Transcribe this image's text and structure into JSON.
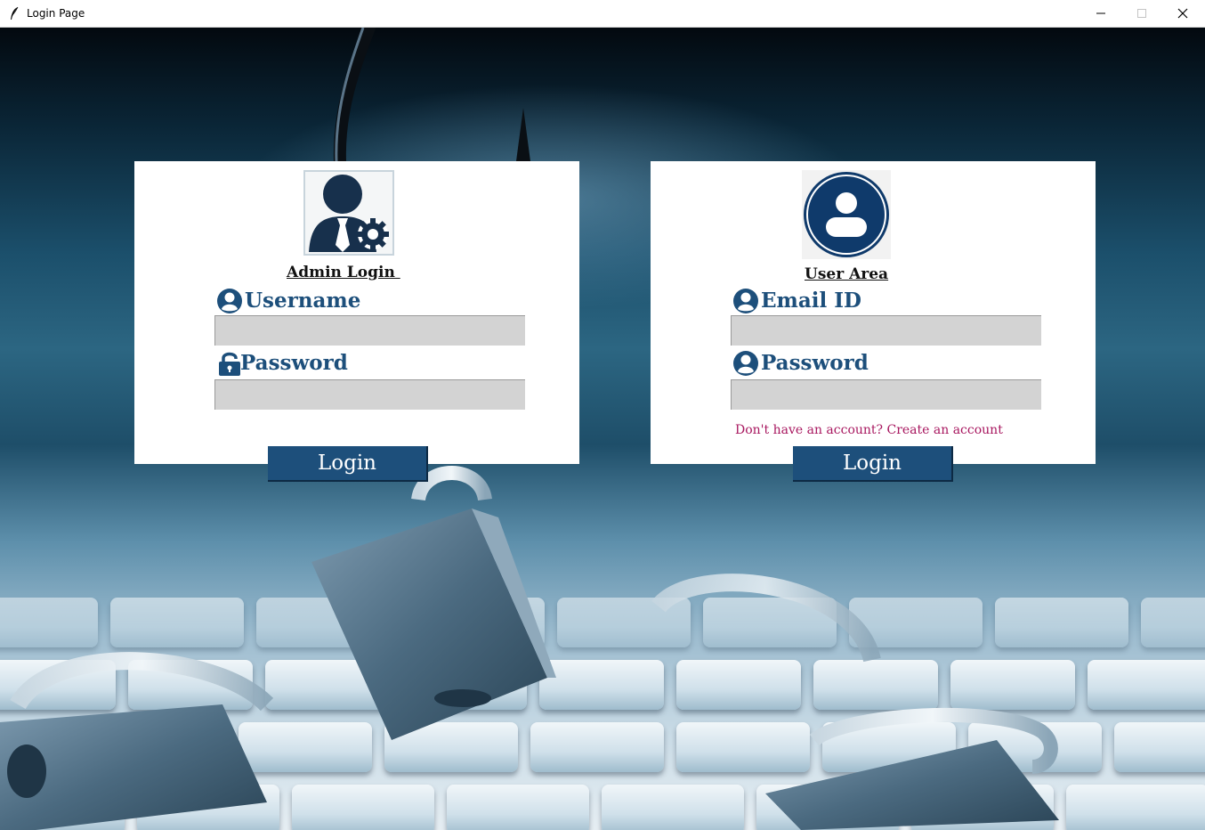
{
  "window": {
    "title": "Login Page"
  },
  "admin": {
    "heading": "Admin Login ",
    "username_label": "Username",
    "username_value": "",
    "password_label": "Password",
    "password_value": "",
    "login_label": "Login"
  },
  "user": {
    "heading": "User Area",
    "email_label": "Email ID",
    "email_value": "",
    "password_label": "Password",
    "password_value": "",
    "signup_link": "Don't have an account? Create an account",
    "login_label": "Login"
  },
  "colors": {
    "accent": "#1d4f7b",
    "input_bg": "#d3d3d3",
    "link": "#a8175f",
    "panel_bg": "#ffffff"
  },
  "icons": {
    "app": "feather-icon",
    "admin_avatar": "admin-gear-avatar-icon",
    "user_avatar": "user-circle-avatar-icon",
    "username": "user-circle-icon",
    "password_admin": "padlock-icon",
    "email": "user-circle-icon",
    "password_user": "user-circle-icon"
  }
}
